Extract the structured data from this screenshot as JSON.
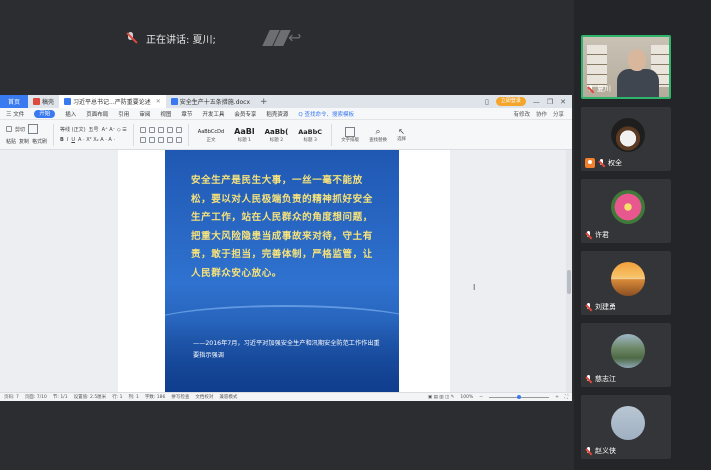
{
  "meeting": {
    "speaking_label": "正在讲话: 夏川;"
  },
  "wps": {
    "tabs": [
      {
        "label": "首页"
      },
      {
        "label": "稿壳"
      },
      {
        "label": "习近平总书记...严防重要论述"
      },
      {
        "label": "安全生产十五条措施.docx"
      }
    ],
    "login_label": "立即登录",
    "menu": [
      "三 文件",
      "开始",
      "插入",
      "页面布局",
      "引用",
      "审阅",
      "视图",
      "章节",
      "开发工具",
      "会员专享",
      "稻壳资源"
    ],
    "menu_search": "Q 查找命令、搜索模板",
    "menu_right": [
      "有修改",
      "协作",
      "分享"
    ],
    "ribbon": {
      "paste": "粘贴",
      "cut": "剪切",
      "copy": "复制",
      "format_painter": "格式刷",
      "font_name": "等线 (正文)",
      "font_size": "五号",
      "styles": [
        {
          "sample": "AaBbCcDd",
          "name": "正文"
        },
        {
          "sample": "AaBl",
          "name": "标题 1"
        },
        {
          "sample": "AaBb(",
          "name": "标题 2"
        },
        {
          "sample": "AaBbC",
          "name": "标题 3"
        }
      ],
      "text_tools": "文字排版",
      "find_replace": "查找替换",
      "select": "选择"
    },
    "document": {
      "quote": "安全生产是民生大事，一丝一毫不能放松，要以对人民极端负责的精神抓好安全生产工作，站在人民群众的角度想问题，把重大风险隐患当成事故来对待，守土有责，敢于担当，完善体制，严格监管，让人民群众安心放心。",
      "attribution": "——2016年7月，习近平对加强安全生产和汛期安全防范工作作出重要指示强调"
    },
    "status": {
      "page": "页码: 7",
      "pages": "页面: 7/10",
      "section": "节: 1/1",
      "position": "设置值: 2.5厘米",
      "line": "行: 1",
      "column": "列: 1",
      "words": "字数: 186",
      "spell": "拼写检查",
      "doc_check": "文档校对",
      "compat": "兼容模式",
      "zoom": "100%"
    }
  },
  "participants": [
    {
      "name": "夏川",
      "avatar": "video-feed",
      "active": true
    },
    {
      "name": "权全",
      "avatar": "coffee-cup"
    },
    {
      "name": "许君",
      "avatar": "pink-flower"
    },
    {
      "name": "刘建勇",
      "avatar": "sunset"
    },
    {
      "name": "慈志江",
      "avatar": "mountain-stream"
    },
    {
      "name": "赵义侠",
      "avatar": "sky"
    }
  ],
  "colors": {
    "poster_blue": "#2563c2",
    "quote_yellow": "#f6e27a",
    "wps_blue": "#3a7af0",
    "active_green": "#2fb46c",
    "mute_red": "#e0483e"
  }
}
